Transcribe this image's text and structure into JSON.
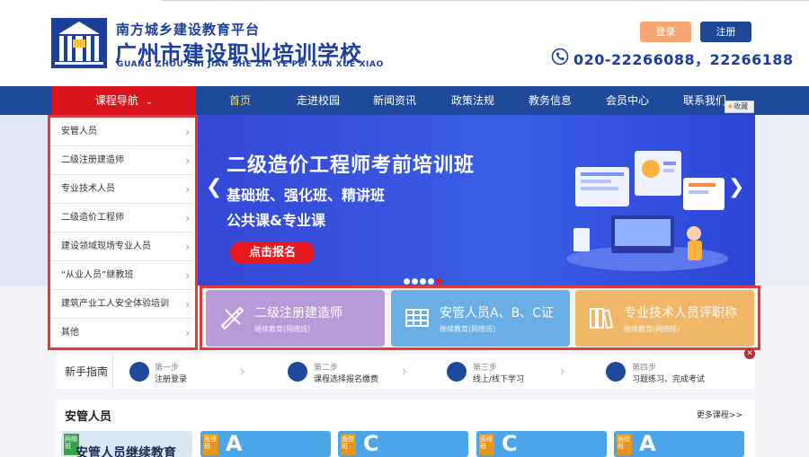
{
  "header": {
    "org_line": "南方城乡建设教育平台",
    "school_name": "广州市建设职业培训学校",
    "school_pinyin": "GUANG ZHOU SHI JIAN SHE ZHI YE PEI XUN XUE XIAO",
    "login_label": "登录",
    "register_label": "注册",
    "phone": "020-22266088，22266188",
    "brand_color": "#1c3f9c"
  },
  "nav": {
    "course_nav_label": "课程导航",
    "items": [
      {
        "label": "首页",
        "active": true
      },
      {
        "label": "走进校园"
      },
      {
        "label": "新闻资讯"
      },
      {
        "label": "政策法规"
      },
      {
        "label": "教务信息"
      },
      {
        "label": "会员中心"
      },
      {
        "label": "联系我们"
      }
    ],
    "fav_label": "收藏",
    "nav_color": "#1f4a9b",
    "accent_color": "#d8151c"
  },
  "sidebar": {
    "items": [
      "安管人员",
      "二级注册建造师",
      "专业技术人员",
      "二级造价工程师",
      "建设领域现场专业人员",
      "“从业人员”继教班",
      "建筑产业工人安全体验培训",
      "其他"
    ]
  },
  "banner": {
    "title": "二级造价工程师考前培训班",
    "line1": "基础班、强化班、精讲班",
    "line2": "公共课&专业课",
    "cta": "点击报名",
    "slide_count": 5,
    "active_slide": 5
  },
  "cards": [
    {
      "title": "二级注册建造师",
      "sub": "继续教育(网络班)",
      "color": "#b79ad8",
      "icon": "ruler-pencil-icon"
    },
    {
      "title": "安管人员A、B、C证",
      "sub": "继续教育(网络班)",
      "color": "#6aaee6",
      "icon": "scaffold-icon"
    },
    {
      "title": "专业技术人员评职称",
      "sub": "继续教育(网络班)",
      "color": "#f0b768",
      "icon": "books-icon"
    }
  ],
  "guide": {
    "label": "新手指南",
    "steps": [
      {
        "no": "第一步",
        "desc": "注册登录"
      },
      {
        "no": "第二步",
        "desc": "课程选择报名缴费"
      },
      {
        "no": "第三步",
        "desc": "线上/线下学习"
      },
      {
        "no": "第四步",
        "desc": "习题练习、完成考试"
      }
    ]
  },
  "section": {
    "title": "安管人员",
    "more": "更多课程>>",
    "thumbs": [
      {
        "badge": "网络班",
        "text": "安管人员继续教育"
      },
      {
        "badge": "面授班",
        "big": "A"
      },
      {
        "badge": "面授班",
        "big": "C"
      },
      {
        "badge": "面授班",
        "big": "C"
      },
      {
        "badge": "面授班",
        "big": "A"
      }
    ]
  }
}
